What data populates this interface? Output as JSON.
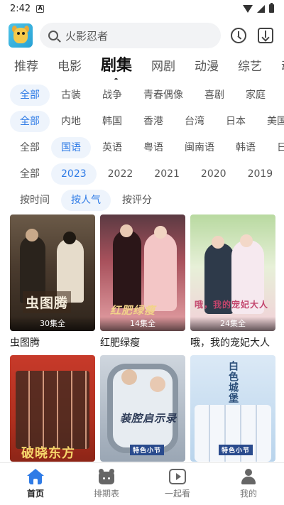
{
  "status_bar": {
    "time": "2:42",
    "notif": "A"
  },
  "header": {
    "search_placeholder": "火影忍者",
    "logo_icon": "app-logo-icon",
    "history_icon": "clock-icon",
    "download_icon": "download-icon"
  },
  "category_tabs": [
    "推荐",
    "电影",
    "剧集",
    "网剧",
    "动漫",
    "综艺",
    "动"
  ],
  "active_category": "剧集",
  "filters": {
    "genre": [
      "全部",
      "古装",
      "战争",
      "青春偶像",
      "喜剧",
      "家庭"
    ],
    "region": [
      "全部",
      "内地",
      "韩国",
      "香港",
      "台湾",
      "日本",
      "美国"
    ],
    "language": [
      "全部",
      "国语",
      "英语",
      "粤语",
      "闽南语",
      "韩语",
      "日"
    ],
    "year": [
      "全部",
      "2023",
      "2022",
      "2021",
      "2020",
      "2019"
    ],
    "sort": [
      "按时间",
      "按人气",
      "按评分"
    ]
  },
  "cards_row1": [
    {
      "title": "虫图腾",
      "badge": "30集全",
      "poster_text": "虫图腾"
    },
    {
      "title": "红肥绿瘦",
      "badge": "14集全",
      "poster_text": "红肥绿瘦"
    },
    {
      "title": "哦，我的宠妃大人",
      "badge": "24集全",
      "poster_text": "哦，我的宠妃大人"
    }
  ],
  "cards_row2": [
    {
      "poster_text": "破晓东方"
    },
    {
      "poster_text": "装腔启示录",
      "sub": "特色小节"
    },
    {
      "poster_text": "白色城堡",
      "sub": "特色小节"
    }
  ],
  "bottom_nav": [
    "首页",
    "排期表",
    "一起看",
    "我的"
  ],
  "colors": {
    "accent": "#2f7be6",
    "chip_bg": "#eef4fc"
  }
}
